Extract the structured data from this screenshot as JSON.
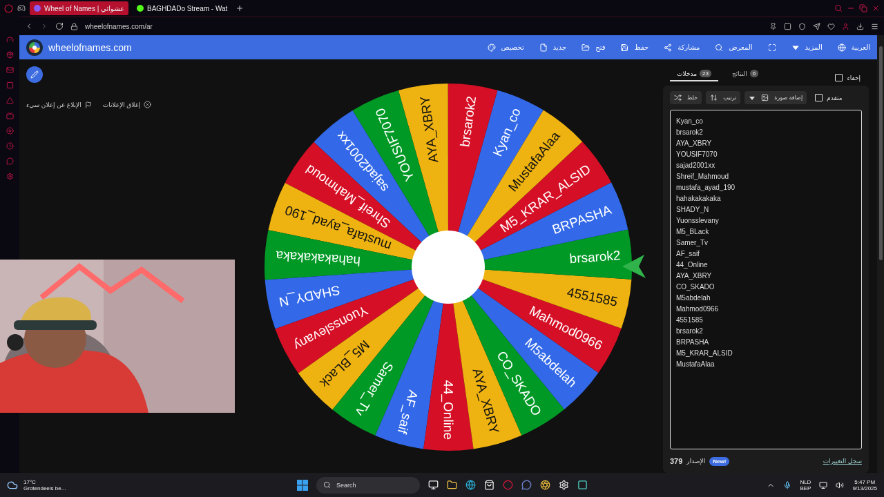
{
  "browser": {
    "tabs": [
      {
        "title": "Wheel of Names | عشوائي",
        "selected": true
      },
      {
        "title": "BAGHDADo Stream - Wat",
        "selected": false
      }
    ],
    "address": "wheelofnames.com/ar"
  },
  "header": {
    "brand": "wheelofnames.com",
    "nav": [
      "العربية",
      "المزيد",
      "المعرض",
      "مشاركة",
      "حفظ",
      "فتح",
      "جديد",
      "تخصيص"
    ]
  },
  "ads": {
    "close": "إغلاق الإعلانات",
    "report": "الإبلاغ عن إعلان سيء"
  },
  "wheel": {
    "segments": [
      {
        "label": "Kyan_co",
        "color": "#3369e8"
      },
      {
        "label": "brsarok2",
        "color": "#d50f25"
      },
      {
        "label": "AYA_XBRY",
        "color": "#eeb211"
      },
      {
        "label": "YOUSIF7070",
        "color": "#009925"
      },
      {
        "label": "sajad2001xx",
        "color": "#3369e8"
      },
      {
        "label": "Shreif_Mahmoud",
        "color": "#d50f25"
      },
      {
        "label": "mustafa_ayad_190",
        "color": "#eeb211"
      },
      {
        "label": "hahakakakaka",
        "color": "#009925"
      },
      {
        "label": "SHADY_N",
        "color": "#3369e8"
      },
      {
        "label": "Yuonsslevany",
        "color": "#d50f25"
      },
      {
        "label": "M5_BLack",
        "color": "#eeb211"
      },
      {
        "label": "Samer_Tv",
        "color": "#009925"
      },
      {
        "label": "AF_saif",
        "color": "#3369e8"
      },
      {
        "label": "44_Online",
        "color": "#d50f25"
      },
      {
        "label": "AYA_XBRY",
        "color": "#eeb211"
      },
      {
        "label": "CO_SKADO",
        "color": "#009925"
      },
      {
        "label": "M5abdelah",
        "color": "#3369e8"
      },
      {
        "label": "Mahmod0966",
        "color": "#d50f25"
      },
      {
        "label": "4551585",
        "color": "#eeb211"
      },
      {
        "label": "brsarok2",
        "color": "#009925"
      },
      {
        "label": "BRPASHA",
        "color": "#3369e8"
      },
      {
        "label": "M5_KRAR_ALSID",
        "color": "#d50f25"
      },
      {
        "label": "MustafaAlaa",
        "color": "#eeb211"
      }
    ]
  },
  "panel": {
    "entries_tab": {
      "label": "مدخلات",
      "count": "23",
      "selected": true
    },
    "results_tab": {
      "label": "النتائج",
      "count": "6",
      "selected": false
    },
    "hide": {
      "label": "إخفاء",
      "checked": false
    },
    "toolbar": {
      "shuffle": "خلط",
      "sort": "ترتيب",
      "add_image": "إضافة صورة",
      "advanced": {
        "label": "متقدم",
        "checked": false
      }
    },
    "entries": [
      "Kyan_co",
      "brsarok2",
      "AYA_XBRY",
      "YOUSIF7070",
      "sajad2001xx",
      "Shreif_Mahmoud",
      "mustafa_ayad_190",
      "hahakakakaka",
      "SHADY_N",
      "Yuonsslevany",
      "M5_BLack",
      "Samer_Tv",
      "AF_saif",
      "44_Online",
      "AYA_XBRY",
      "CO_SKADO",
      "M5abdelah",
      "Mahmod0966",
      "4551585",
      "brsarok2",
      "BRPASHA",
      "M5_KRAR_ALSID",
      "MustafaAlaa"
    ],
    "footer": {
      "changelog": "سجل التغييرات",
      "badge": "New!",
      "version_label": "الإصدار",
      "version": "379"
    }
  },
  "taskbar": {
    "weather": {
      "temp": "17°C",
      "condition": "Grotendeels be..."
    },
    "search_label": "Search",
    "language": [
      "NLD",
      "BEP"
    ],
    "time": "5:47 PM",
    "date": "9/13/2025"
  }
}
